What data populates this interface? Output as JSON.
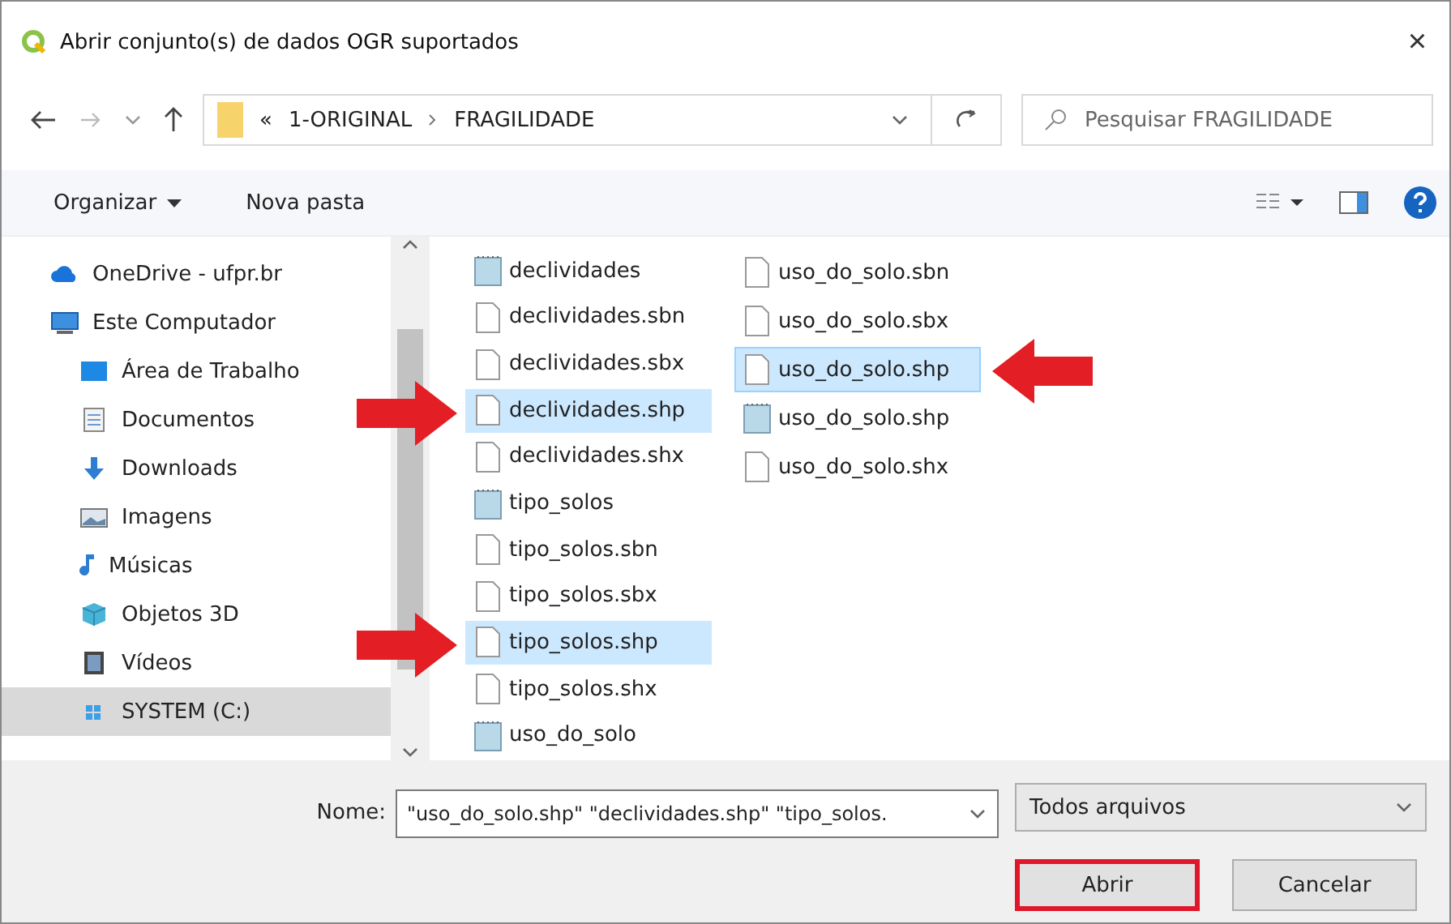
{
  "window": {
    "title": "Abrir conjunto(s) de dados OGR suportados",
    "close": "×"
  },
  "address": {
    "overflow": "«",
    "crumbs": [
      "1-ORIGINAL",
      "FRAGILIDADE"
    ],
    "search_placeholder": "Pesquisar FRAGILIDADE"
  },
  "toolbar": {
    "organize": "Organizar",
    "new_folder": "Nova pasta"
  },
  "sidebar": {
    "items": [
      {
        "label": "OneDrive - ufpr.br",
        "kind": "cloud",
        "selected": false
      },
      {
        "label": "Este Computador",
        "kind": "computer",
        "selected": false,
        "children": [
          {
            "label": "Área de Trabalho",
            "kind": "desktop",
            "selected": false
          },
          {
            "label": "Documentos",
            "kind": "documents",
            "selected": false
          },
          {
            "label": "Downloads",
            "kind": "downloads",
            "selected": false
          },
          {
            "label": "Imagens",
            "kind": "pictures",
            "selected": false
          },
          {
            "label": "Músicas",
            "kind": "music",
            "selected": false
          },
          {
            "label": "Objetos 3D",
            "kind": "objects",
            "selected": false
          },
          {
            "label": "Vídeos",
            "kind": "videos",
            "selected": false
          },
          {
            "label": "SYSTEM (C:)",
            "kind": "drive",
            "selected": true
          }
        ]
      }
    ]
  },
  "files": {
    "columns": [
      [
        {
          "name": "declividades",
          "kind": "layer",
          "selected": false
        },
        {
          "name": "declividades.sbn",
          "kind": "file",
          "selected": false
        },
        {
          "name": "declividades.sbx",
          "kind": "file",
          "selected": false
        },
        {
          "name": "declividades.shp",
          "kind": "file",
          "selected": true,
          "annotated": true
        },
        {
          "name": "declividades.shx",
          "kind": "file",
          "selected": false
        },
        {
          "name": "tipo_solos",
          "kind": "layer",
          "selected": false
        },
        {
          "name": "tipo_solos.sbn",
          "kind": "file",
          "selected": false
        },
        {
          "name": "tipo_solos.sbx",
          "kind": "file",
          "selected": false
        },
        {
          "name": "tipo_solos.shp",
          "kind": "file",
          "selected": true,
          "annotated": true
        },
        {
          "name": "tipo_solos.shx",
          "kind": "file",
          "selected": false
        },
        {
          "name": "uso_do_solo",
          "kind": "layer",
          "selected": false
        }
      ],
      [
        {
          "name": "uso_do_solo.sbn",
          "kind": "file",
          "selected": false
        },
        {
          "name": "uso_do_solo.sbx",
          "kind": "file",
          "selected": false
        },
        {
          "name": "uso_do_solo.shp",
          "kind": "file",
          "selected": true,
          "annotated": true
        },
        {
          "name": "uso_do_solo.shp",
          "kind": "layer",
          "selected": false
        },
        {
          "name": "uso_do_solo.shx",
          "kind": "file",
          "selected": false
        }
      ]
    ]
  },
  "footer": {
    "name_label": "Nome:",
    "name_value": "\"uso_do_solo.shp\" \"declividades.shp\" \"tipo_solos.",
    "filter": "Todos arquivos",
    "buttons": [
      {
        "label": "Abrir",
        "highlighted": true
      },
      {
        "label": "Cancelar",
        "highlighted": false
      }
    ]
  }
}
